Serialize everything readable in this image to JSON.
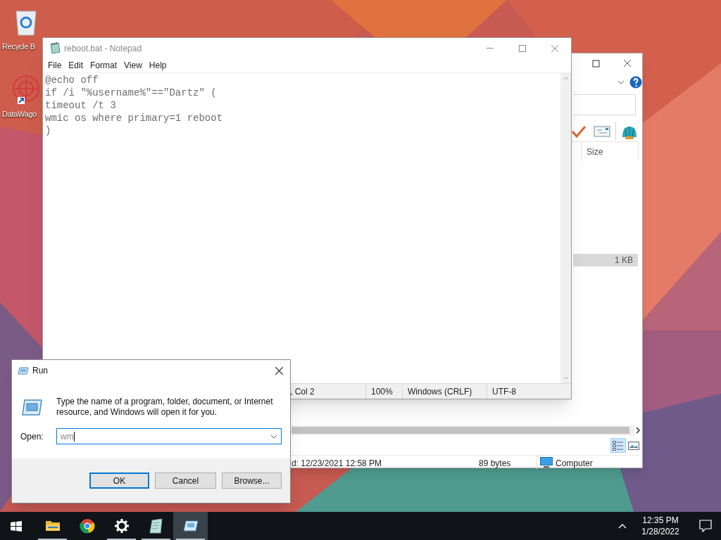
{
  "desktop_icons": [
    {
      "kind": "recycle-bin",
      "label": "Recycle B"
    },
    {
      "kind": "shortcut",
      "label": "DataWago"
    }
  ],
  "explorer": {
    "column_header": "Size",
    "selected_row": {
      "size": "1 KB",
      "selected": true
    },
    "status_bar": [
      "d: 12/23/2021 12:58 PM",
      "89 bytes",
      "Computer"
    ]
  },
  "notepad": {
    "title": "reboot.bat - Notepad",
    "menu": [
      "File",
      "Edit",
      "Format",
      "View",
      "Help"
    ],
    "lines": [
      "@echo off",
      "if /i \"%username%\"==\"Dartz\" (",
      "timeout /t 3",
      "wmic os where primary=1 reboot",
      ")"
    ],
    "status_bar": [
      ", Col 2",
      "100%",
      "Windows (CRLF)",
      "UTF-8"
    ]
  },
  "run_dialog": {
    "title": "Run",
    "message": "Type the name of a program, folder, document, or Internet resource, and Windows will open it for you.",
    "open_label": "Open:",
    "value": "wm",
    "buttons": [
      {
        "label": "OK",
        "default": true
      },
      {
        "label": "Cancel",
        "default": false
      },
      {
        "label": "Browse...",
        "default": false
      }
    ]
  },
  "taskbar": {
    "apps": [
      {
        "kind": "folder",
        "running": true,
        "active": false
      },
      {
        "kind": "chrome",
        "running": false,
        "active": false
      },
      {
        "kind": "settings",
        "running": true,
        "active": false
      },
      {
        "kind": "notepad",
        "running": true,
        "active": false
      },
      {
        "kind": "run",
        "running": true,
        "active": true
      }
    ],
    "time": "12:35 PM",
    "date": "1/28/2022"
  }
}
